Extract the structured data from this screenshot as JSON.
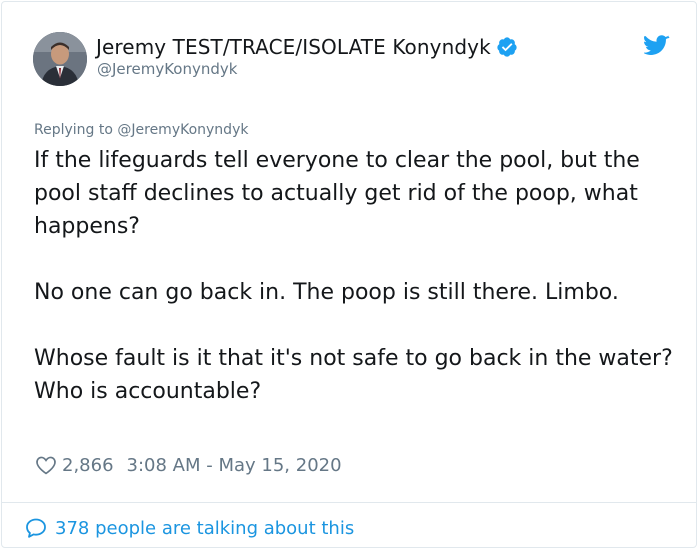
{
  "user": {
    "display_name": "Jeremy TEST/TRACE/ISOLATE Konyndyk",
    "handle": "@JeremyKonyndyk",
    "verified_icon": "verified-badge-icon",
    "avatar_icon": "profile-photo"
  },
  "platform_icon": "twitter-bird-icon",
  "reply_context": "Replying to @JeremyKonyndyk",
  "tweet": {
    "paragraphs": [
      "If the lifeguards tell everyone to clear the pool, but the pool staff declines to actually get rid of the poop, what happens?",
      "No one can go back in. The poop is still there. Limbo.",
      "Whose fault is it that it's not safe to go back in the water? Who is accountable?"
    ]
  },
  "meta": {
    "like_count": "2,866",
    "timestamp": "3:08 AM - May 15, 2020"
  },
  "footer": {
    "conversation_text": "378 people are talking about this"
  },
  "colors": {
    "accent": "#1da1f2",
    "link": "#1b95e0",
    "muted": "#657786",
    "text": "#14171a",
    "border": "#e1e8ed"
  }
}
